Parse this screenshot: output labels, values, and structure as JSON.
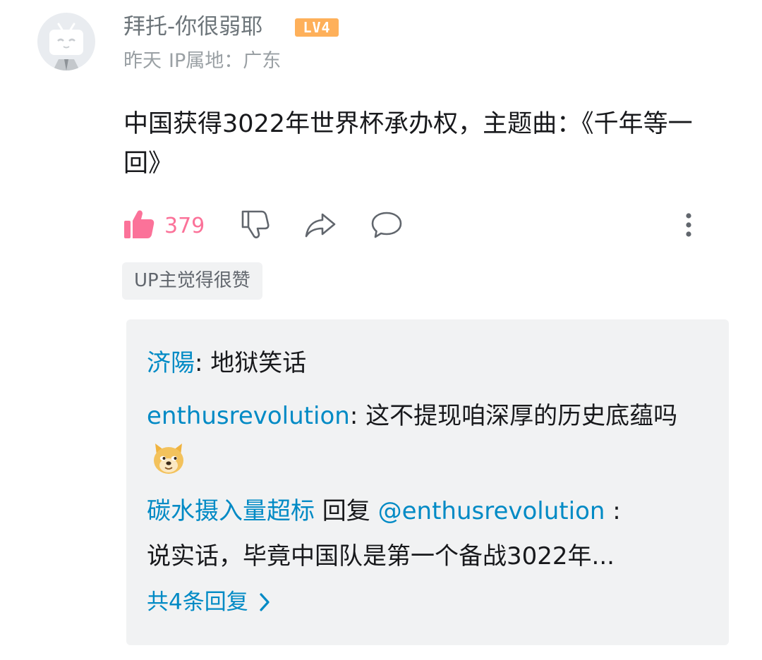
{
  "comment": {
    "username": "拜托-你很弱耶",
    "level_badge": "LV4",
    "time": "昨天",
    "ip_location": "IP属地：广东",
    "text": "中国获得3022年世界杯承办权，主题曲：《千年等一回》",
    "like_count": "379",
    "up_tag": "UP主觉得很赞",
    "colors": {
      "accent_pink": "#fb7299",
      "link_blue": "#008ac5",
      "badge_orange": "#feb05a"
    },
    "icons": [
      "avatar-tv-icon",
      "thumbs-up-icon",
      "thumbs-down-icon",
      "share-icon",
      "comment-icon",
      "more-vertical-icon",
      "doge-emoji-icon",
      "chevron-right-icon"
    ]
  },
  "replies": {
    "items": [
      {
        "user": "济陽",
        "sep": ": ",
        "text": "地狱笑话"
      },
      {
        "user": "enthusrevolution",
        "sep": ": ",
        "text": "这不提现咱深厚的历史底蕴吗"
      },
      {
        "user": "碳水摄入量超标",
        "reply_word": " 回复 ",
        "mention": "@enthusrevolution",
        "sep": " : ",
        "text": "说实话，毕竟中国队是第一个备战3022年..."
      }
    ],
    "more_label": "共4条回复"
  }
}
